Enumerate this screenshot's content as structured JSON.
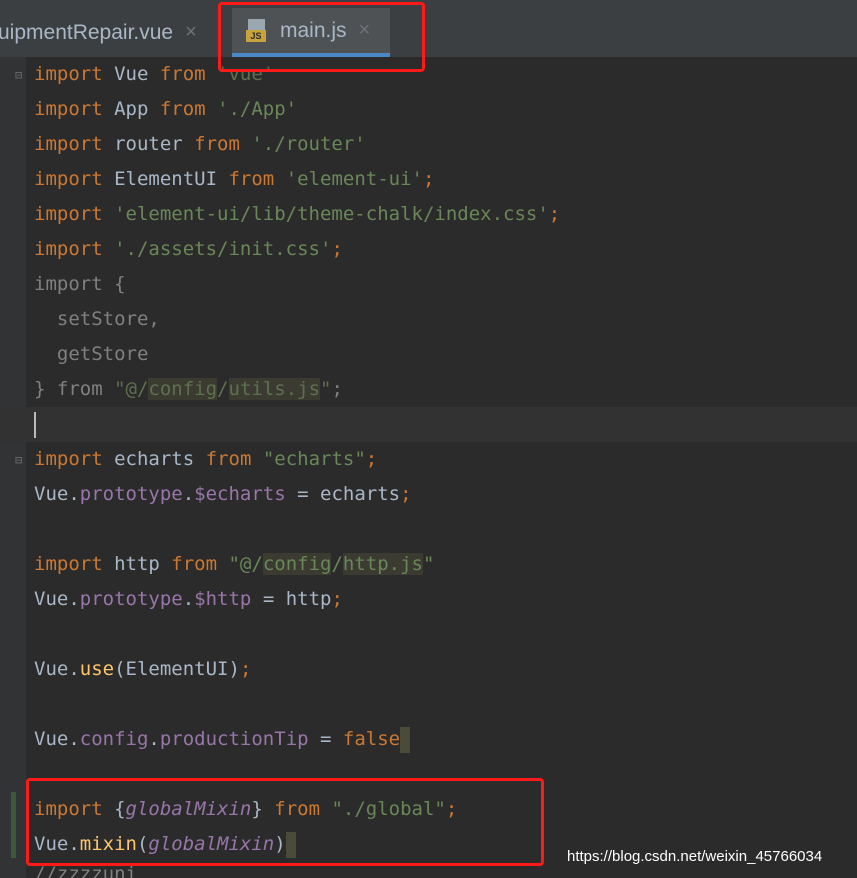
{
  "tabs": [
    {
      "label": "uipmentRepair.vue",
      "close": "×",
      "active": false
    },
    {
      "label": "main.js",
      "close": "×",
      "active": true,
      "icon": "js-file-icon",
      "icon_text": "JS"
    }
  ],
  "code": {
    "l1": {
      "a": "import",
      "b": " Vue ",
      "c": "from",
      "d": " 'vue'"
    },
    "l2": {
      "a": "import",
      "b": " App ",
      "c": "from",
      "d": " './App'"
    },
    "l3": {
      "a": "import",
      "b": " router ",
      "c": "from",
      "d": " './router'"
    },
    "l4": {
      "a": "import",
      "b": " ElementUI ",
      "c": "from",
      "d": " 'element-ui'",
      "e": ";"
    },
    "l5": {
      "a": "import",
      "b": " ",
      "d": "'element-ui/lib/theme-chalk/index.css'",
      "e": ";"
    },
    "l6": {
      "a": "import",
      "b": " ",
      "d": "'./assets/init.css'",
      "e": ";"
    },
    "l7": {
      "a": "import {"
    },
    "l8": {
      "a": "  setStore,"
    },
    "l9": {
      "a": "  getStore"
    },
    "l10": {
      "a": "} from ",
      "b": "\"@/",
      "c": "config",
      "d": "/",
      "e": "utils.js",
      "f": "\"",
      "g": ";"
    },
    "l12": {
      "a": "import",
      "b": " ",
      "c": "echarts",
      "d": " ",
      "e": "from",
      "f": " \"echarts\"",
      "g": ";"
    },
    "l13": {
      "a": "Vue.",
      "b": "prototype",
      "c": ".",
      "d": "$echarts",
      "e": " = echarts",
      "f": ";"
    },
    "l15": {
      "a": "import",
      "b": " http ",
      "c": "from",
      "d": " \"@/",
      "e": "config",
      "f": "/",
      "g": "http.js",
      "h": "\""
    },
    "l16": {
      "a": "Vue.",
      "b": "prototype",
      "c": ".",
      "d": "$http",
      "e": " = http",
      "f": ";"
    },
    "l18": {
      "a": "Vue.",
      "b": "use",
      "c": "(ElementUI)",
      "d": ";"
    },
    "l20": {
      "a": "Vue.",
      "b": "config",
      "c": ".",
      "d": "productionTip",
      "e": " = ",
      "f": "false"
    },
    "l22": {
      "a": "import",
      "b": " {",
      "c": "globalMixin",
      "d": "} ",
      "e": "from",
      "f": " \"./global\"",
      "g": ";"
    },
    "l23": {
      "a": "Vue.",
      "b": "mixin",
      "c": "(",
      "d": "globalMixin",
      "e": ")"
    },
    "l24": {
      "a": "//zzzzuni"
    }
  },
  "watermark": "https://blog.csdn.net/weixin_45766034",
  "colors": {
    "keyword": "#cc7832",
    "string": "#6a8759",
    "property": "#9876aa",
    "function": "#ffc66d",
    "highlight_box": "#ff1a1a"
  }
}
